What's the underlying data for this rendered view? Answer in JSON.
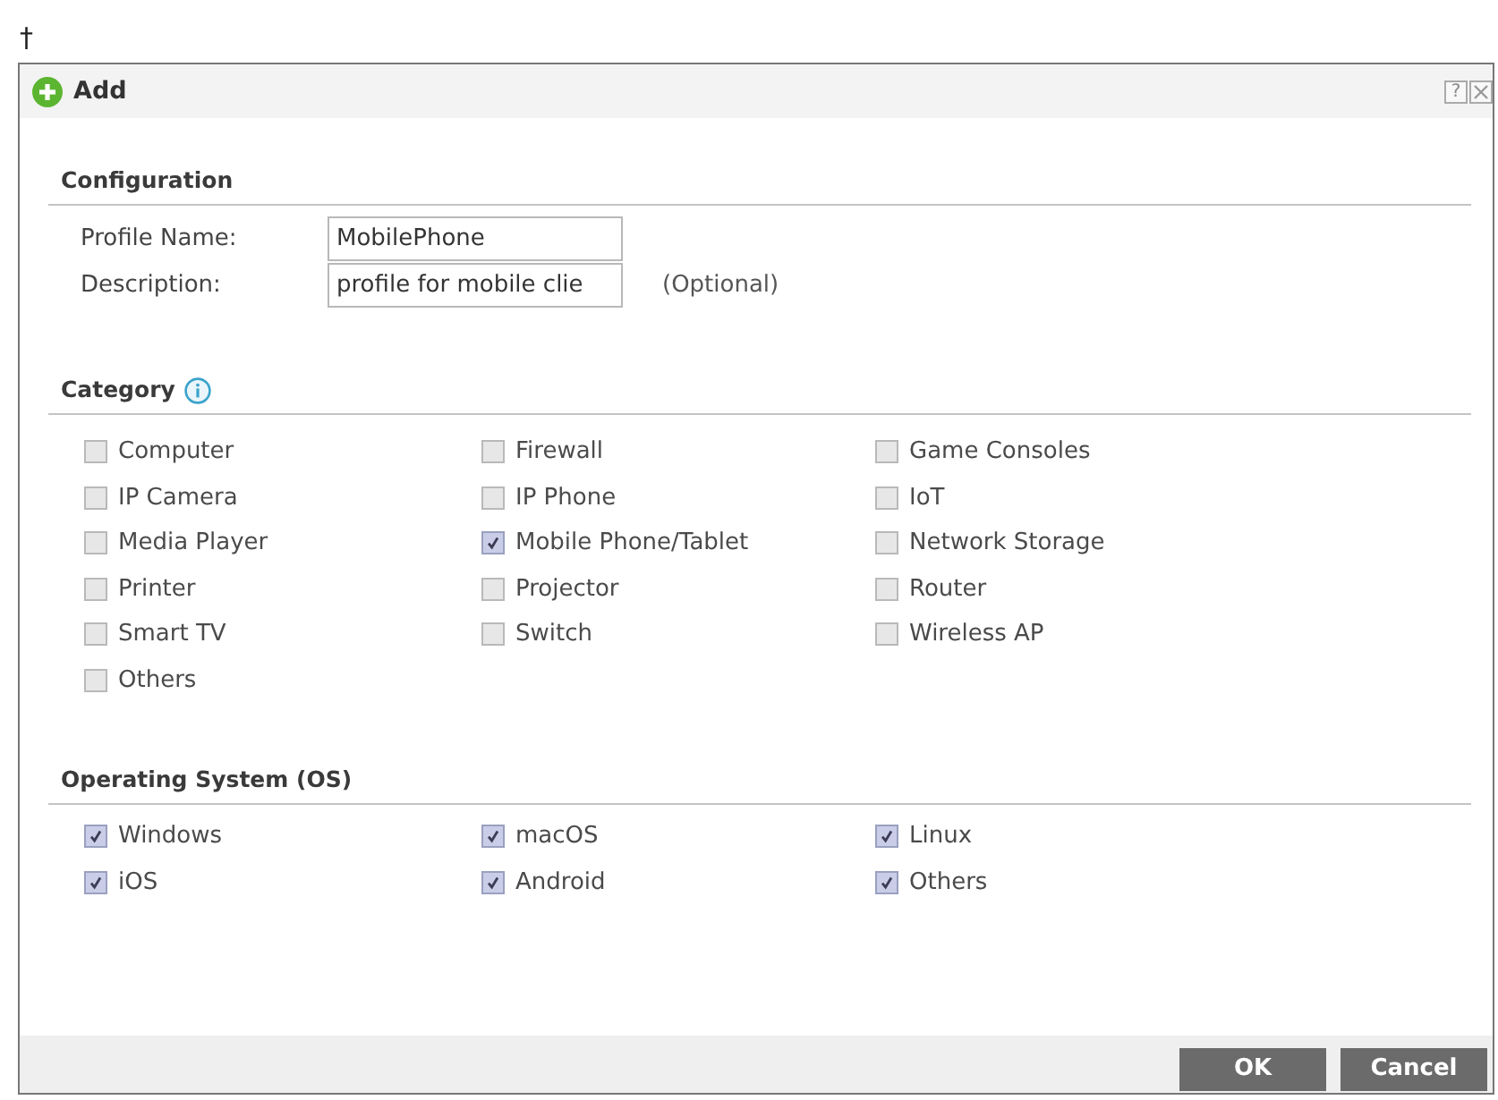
{
  "page_mark": "†",
  "dialog": {
    "title": "Add",
    "help_button": "?"
  },
  "configuration": {
    "heading": "Configuration",
    "fields": [
      {
        "label": "Profile Name:",
        "value": "MobilePhone"
      },
      {
        "label": "Description:",
        "value": "profile for mobile clie",
        "note": "(Optional)"
      }
    ]
  },
  "category": {
    "heading": "Category",
    "items": [
      {
        "label": "Computer",
        "checked": false
      },
      {
        "label": "Firewall",
        "checked": false
      },
      {
        "label": "Game Consoles",
        "checked": false
      },
      {
        "label": "IP Camera",
        "checked": false
      },
      {
        "label": "IP Phone",
        "checked": false
      },
      {
        "label": "IoT",
        "checked": false
      },
      {
        "label": "Media Player",
        "checked": false
      },
      {
        "label": "Mobile Phone/Tablet",
        "checked": true
      },
      {
        "label": "Network Storage",
        "checked": false
      },
      {
        "label": "Printer",
        "checked": false
      },
      {
        "label": "Projector",
        "checked": false
      },
      {
        "label": "Router",
        "checked": false
      },
      {
        "label": "Smart TV",
        "checked": false
      },
      {
        "label": "Switch",
        "checked": false
      },
      {
        "label": "Wireless AP",
        "checked": false
      },
      {
        "label": "Others",
        "checked": false
      }
    ]
  },
  "operating_system": {
    "heading": "Operating System (OS)",
    "items": [
      {
        "label": "Windows",
        "checked": true
      },
      {
        "label": "macOS",
        "checked": true
      },
      {
        "label": "Linux",
        "checked": true
      },
      {
        "label": "iOS",
        "checked": true
      },
      {
        "label": "Android",
        "checked": true
      },
      {
        "label": "Others",
        "checked": true
      }
    ]
  },
  "buttons": [
    "OK",
    "Cancel"
  ]
}
